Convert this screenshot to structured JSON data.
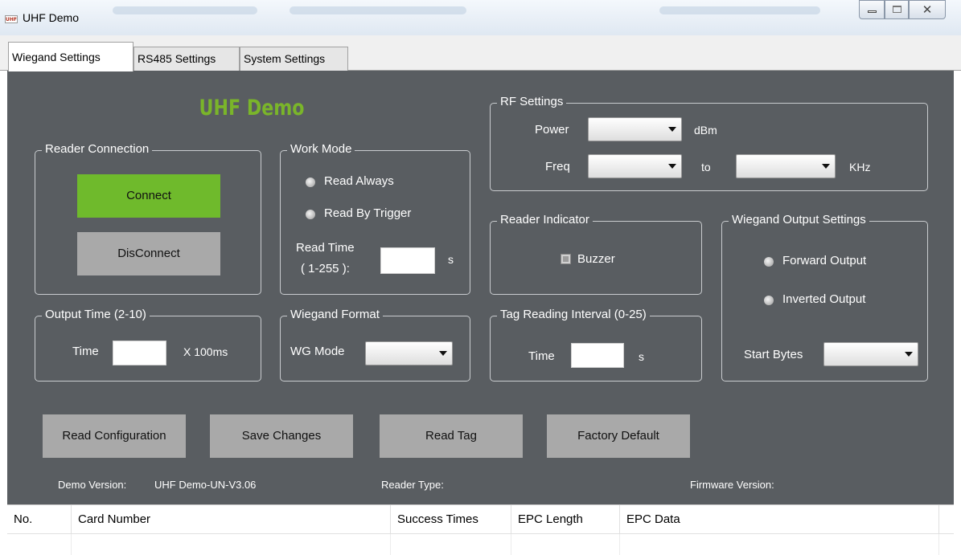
{
  "window": {
    "title": "UHF Demo",
    "icon": "uhf-app-icon",
    "icon_text": "UHF"
  },
  "tabs": [
    "Wiegand Settings",
    "RS485 Settings",
    "System Settings"
  ],
  "active_tab": "Wiegand Settings",
  "banner": "UHF Demo",
  "reader_connection": {
    "legend": "Reader Connection",
    "connect": "Connect",
    "disconnect": "DisConnect"
  },
  "work_mode": {
    "legend": "Work Mode",
    "read_always": "Read Always",
    "read_by_trigger": "Read By Trigger",
    "read_time_label_1": "Read Time",
    "read_time_label_2": "( 1-255 ):",
    "read_time_value": "",
    "read_time_unit": "s"
  },
  "output_time": {
    "legend": "Output Time (2-10)",
    "label": "Time",
    "value": "",
    "unit": "X 100ms"
  },
  "wiegand_format": {
    "legend": "Wiegand Format",
    "label": "WG Mode",
    "value": ""
  },
  "rf_settings": {
    "legend": "RF Settings",
    "power_label": "Power",
    "power_value": "",
    "power_unit": "dBm",
    "freq_label": "Freq",
    "freq_from": "",
    "to_label": "to",
    "freq_to": "",
    "freq_unit": "KHz"
  },
  "reader_indicator": {
    "legend": "Reader Indicator",
    "buzzer": "Buzzer"
  },
  "tag_interval": {
    "legend": "Tag Reading Interval (0-25)",
    "label": "Time",
    "value": "",
    "unit": "s"
  },
  "wiegand_output": {
    "legend": "Wiegand Output Settings",
    "forward": "Forward Output",
    "inverted": "Inverted Output",
    "start_bytes_label": "Start Bytes",
    "start_bytes_value": ""
  },
  "actions": {
    "read_config": "Read Configuration",
    "save": "Save Changes",
    "read_tag": "Read Tag",
    "factory": "Factory Default"
  },
  "info": {
    "demo_version_label": "Demo Version:",
    "demo_version_value": "UHF Demo-UN-V3.06",
    "reader_type_label": "Reader Type:",
    "firmware_label": "Firmware Version:"
  },
  "table": {
    "columns": [
      "No.",
      "Card Number",
      "Success Times",
      "EPC Length",
      "EPC Data"
    ],
    "rows": []
  },
  "colors": {
    "panel_bg": "#595d61",
    "banner_green": "#7ab52a",
    "connect_green": "#6fba2c",
    "gray_button": "#a9a9a9"
  }
}
